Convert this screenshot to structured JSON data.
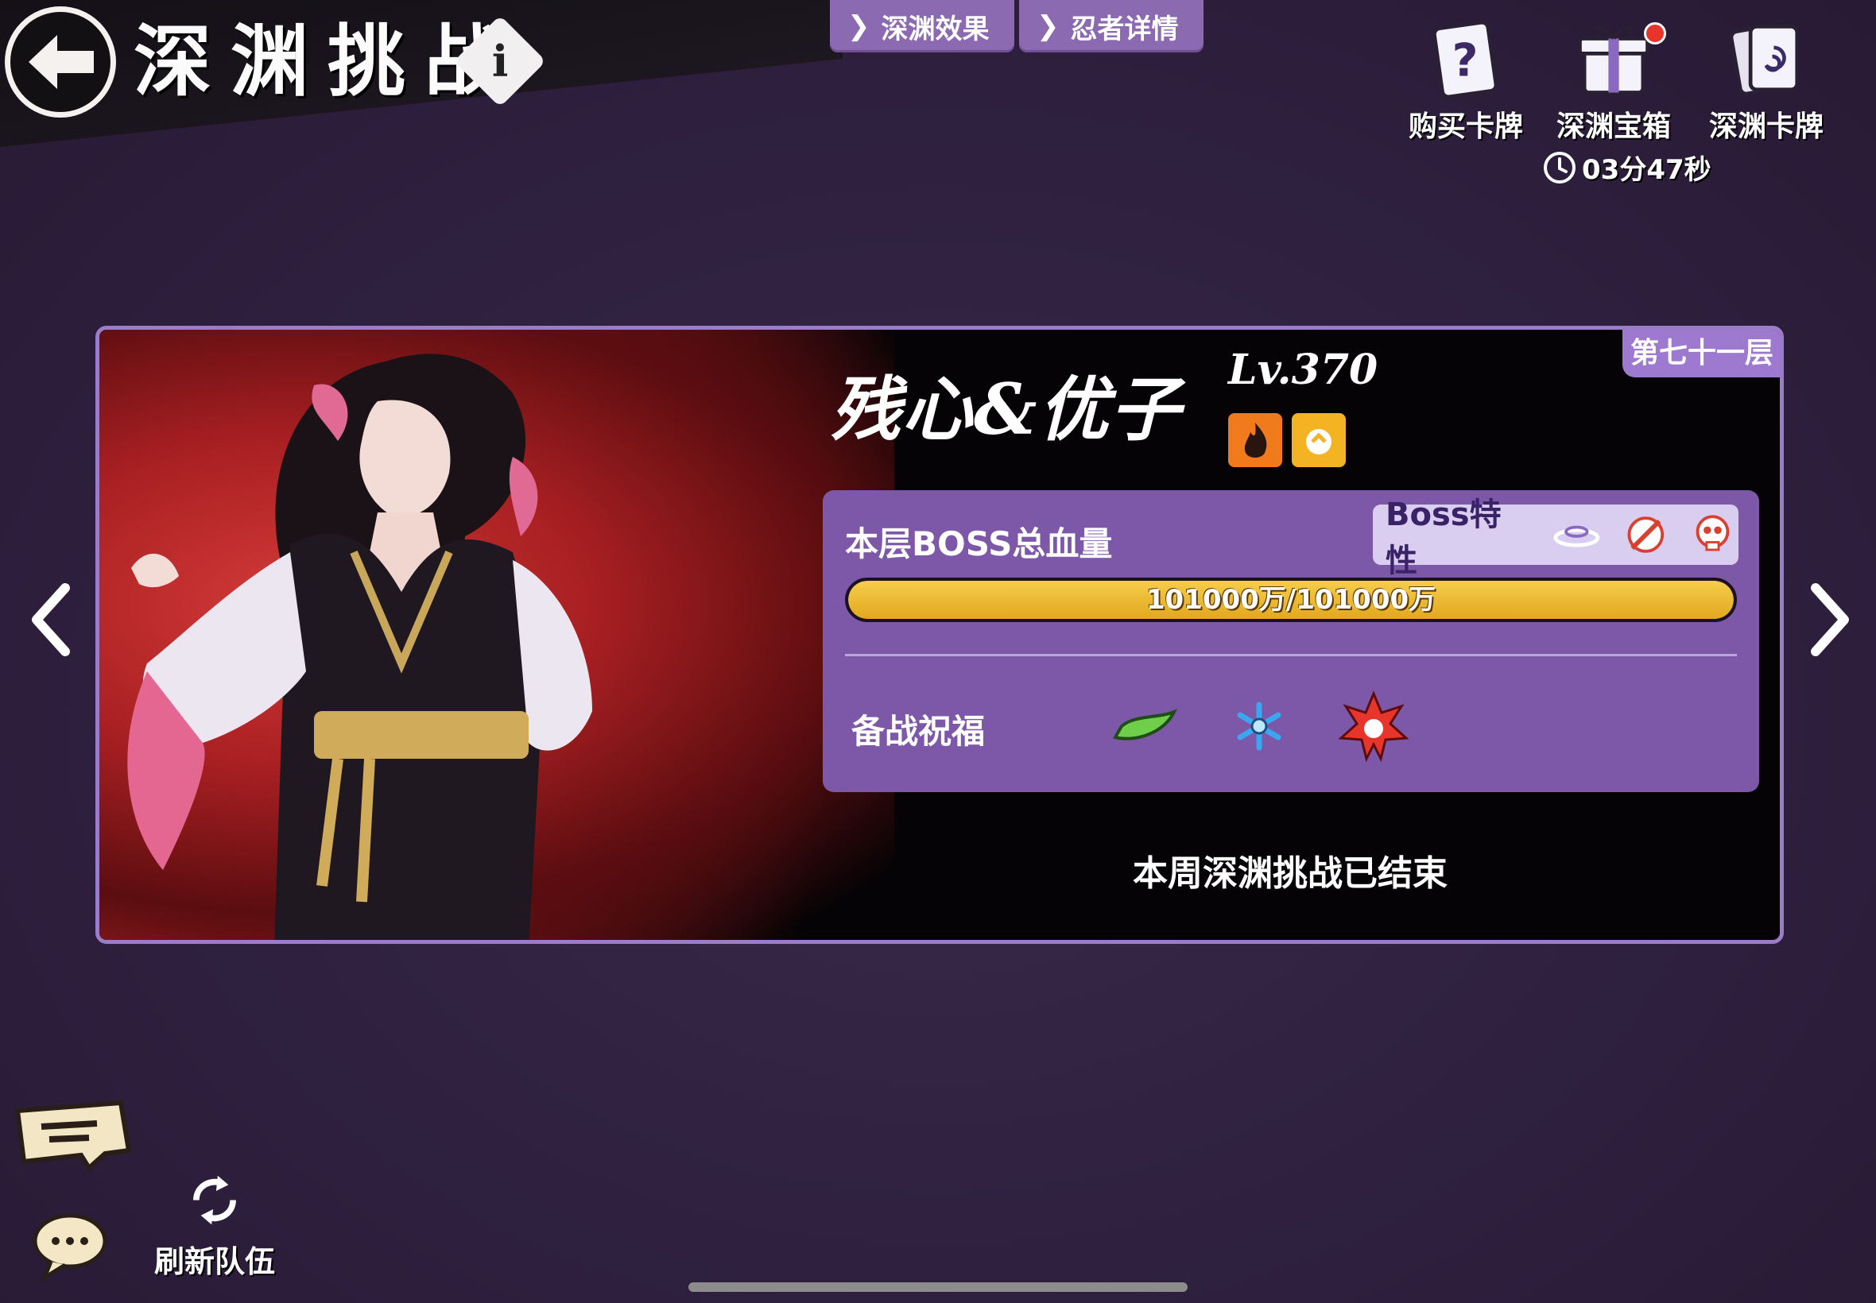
{
  "header": {
    "title": "深渊挑战",
    "info_icon": "i"
  },
  "top_tabs": [
    {
      "label": "深渊效果"
    },
    {
      "label": "忍者详情"
    }
  ],
  "resources": [
    {
      "label": "购买卡牌",
      "icon": "card-question-icon"
    },
    {
      "label": "深渊宝箱",
      "icon": "gift-box-icon",
      "has_badge": true
    },
    {
      "label": "深渊卡牌",
      "icon": "abyss-card-icon"
    }
  ],
  "timer": "03分47秒",
  "panel": {
    "floor": "第七十一层",
    "boss_name": "残心&优子",
    "boss_level": "Lv.370",
    "hp_label": "本层BOSS总血量",
    "hp_text": "101000万/101000万",
    "hp_fraction": 1.0,
    "traits_label": "Boss特性",
    "blessing_label": "备战祝福",
    "ended_text": "本周深渊挑战已结束"
  },
  "bottom": {
    "refresh_label": "刷新队伍"
  },
  "colors": {
    "accent_purple": "#8c6ab2",
    "hp_yellow": "#f0c038",
    "badge_red": "#e8352c"
  }
}
